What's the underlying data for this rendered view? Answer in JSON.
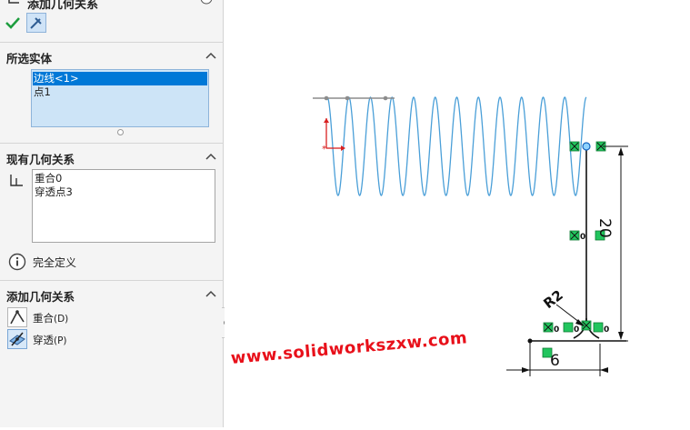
{
  "panel": {
    "title": "添加几何关系",
    "relations_section": {
      "title": "所选实体",
      "items": [
        "边线<1>",
        "点1"
      ]
    },
    "existing_section": {
      "title": "现有几何关系",
      "items": [
        "重合0",
        "穿透点3"
      ]
    },
    "status_text": "完全定义",
    "add_section": {
      "title": "添加几何关系",
      "buttons": [
        {
          "label": "重合",
          "shortcut": "(D)"
        },
        {
          "label": "穿透",
          "shortcut": "(P)"
        }
      ]
    }
  },
  "canvas": {
    "dimension_vertical": "20",
    "dimension_radius": "R2",
    "dimension_horizontal": "6",
    "relation_badge_count": "0",
    "watermark": "www.solidworkszxw.com"
  },
  "colors": {
    "selection": "#0078d7",
    "helix": "#4a9fd8",
    "relation_green": "#22c55e",
    "watermark": "#e8101a"
  }
}
